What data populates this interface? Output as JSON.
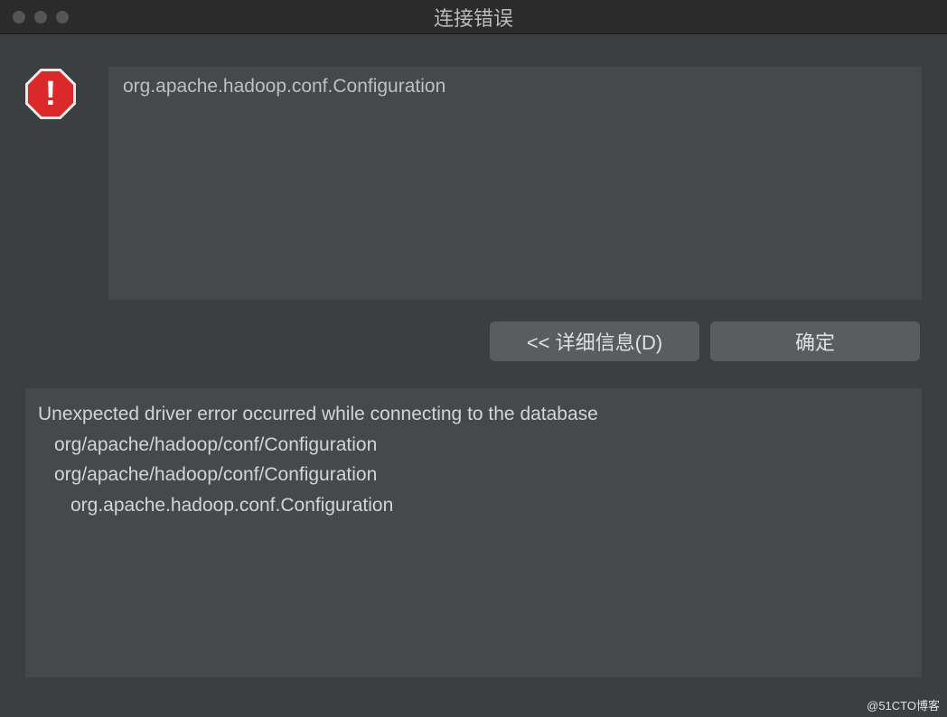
{
  "window": {
    "title": "连接错误"
  },
  "error": {
    "icon_name": "stop-error-icon",
    "mark": "!",
    "message": "org.apache.hadoop.conf.Configuration"
  },
  "buttons": {
    "details": "<< 详细信息(D)",
    "ok": "确定"
  },
  "details": {
    "line1": "Unexpected driver error occurred while connecting to the database",
    "line2": "org/apache/hadoop/conf/Configuration",
    "line3": "org/apache/hadoop/conf/Configuration",
    "line4": "org.apache.hadoop.conf.Configuration"
  },
  "watermark": "@51CTO博客"
}
